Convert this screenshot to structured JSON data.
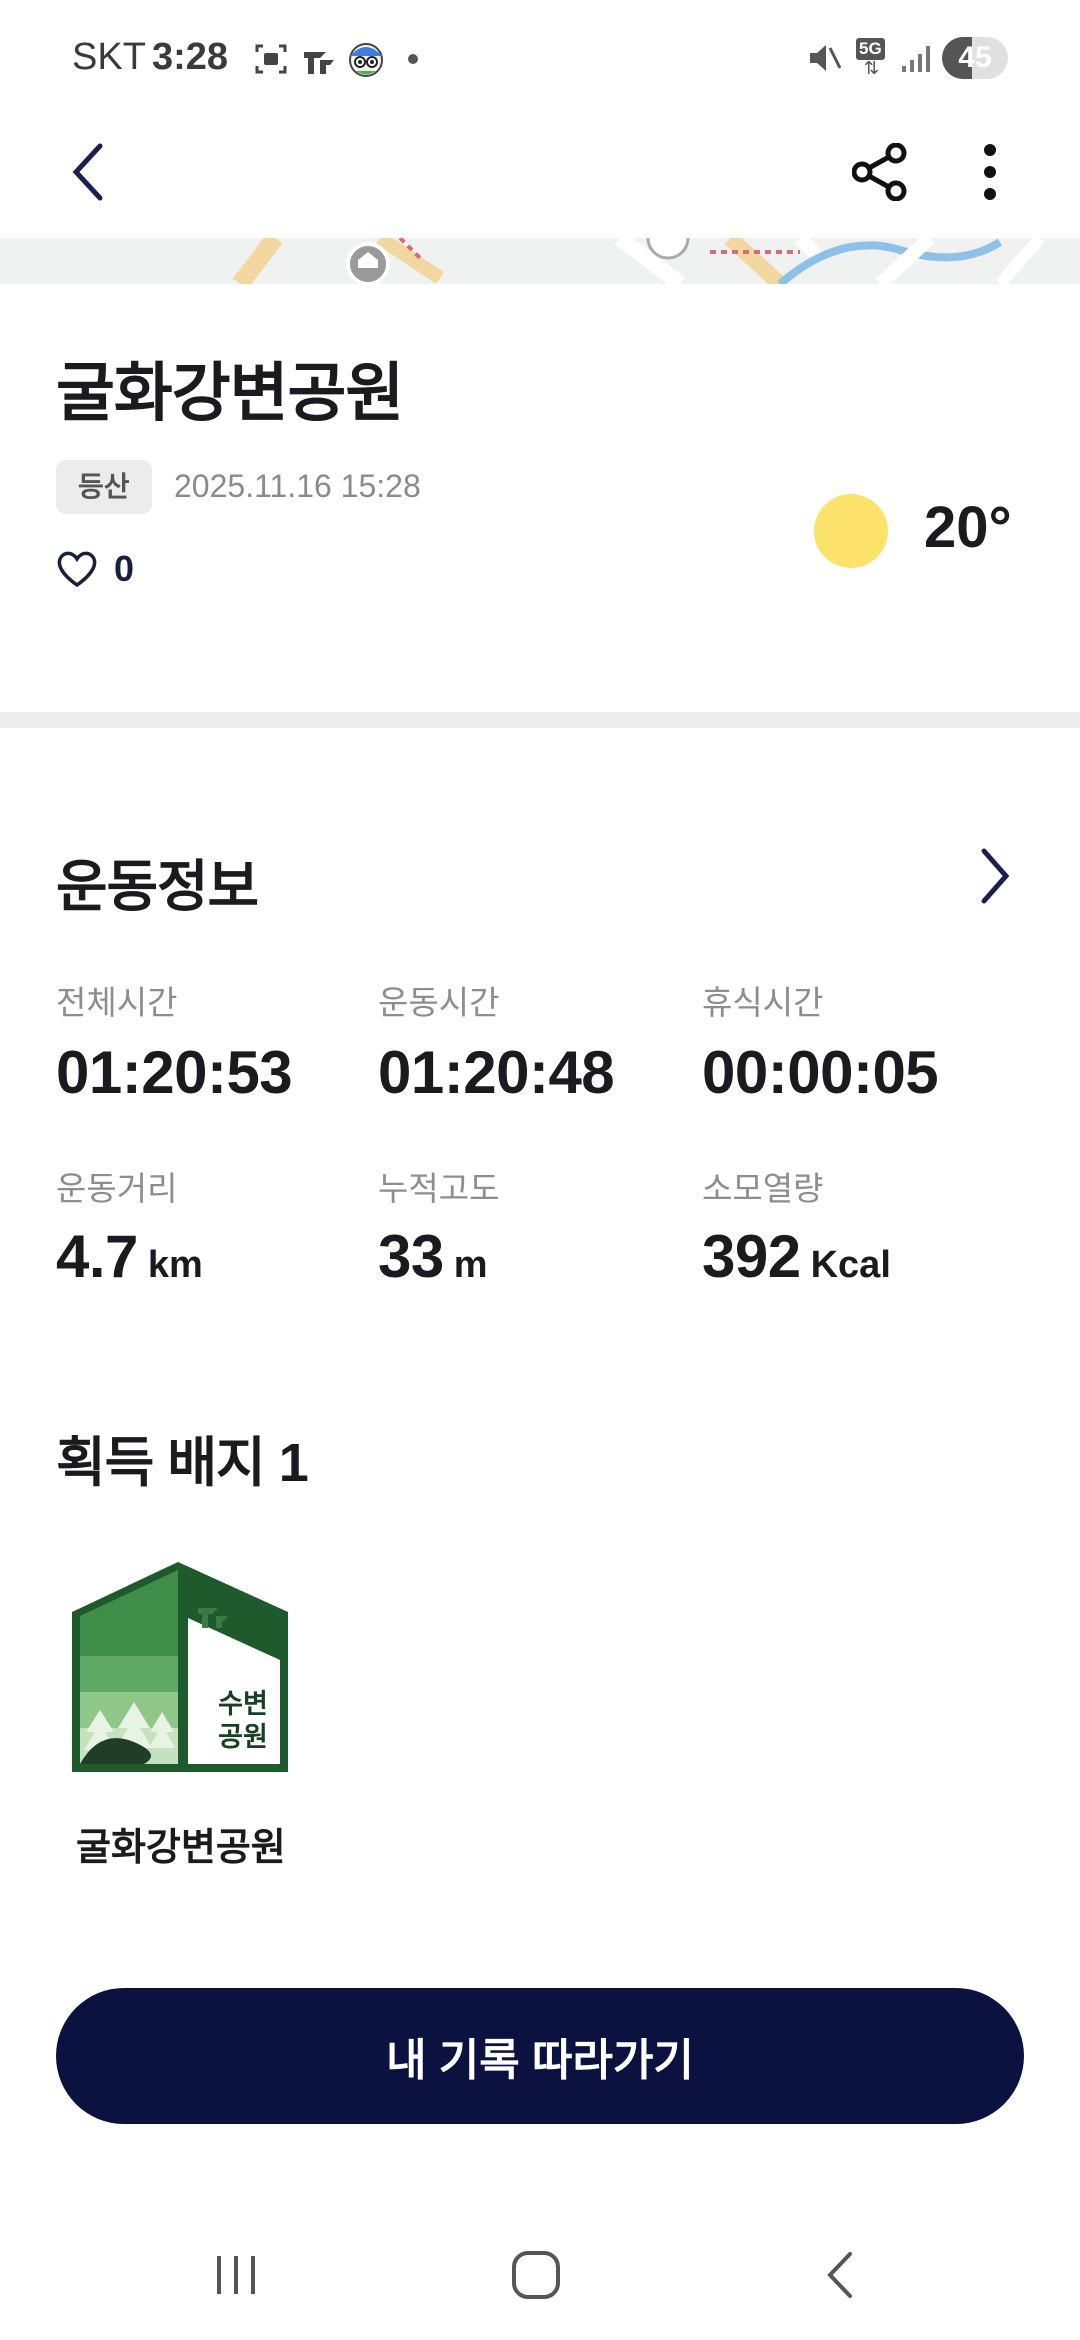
{
  "status_bar": {
    "carrier": "SKT",
    "time": "3:28",
    "network": "5G",
    "battery": "45"
  },
  "place": {
    "title": "굴화강변공원",
    "category": "등산",
    "datetime": "2025.11.16 15:28",
    "likes": "0"
  },
  "weather": {
    "icon": "sun-icon",
    "temperature": "20°"
  },
  "exercise": {
    "section_title": "운동정보",
    "stats": [
      {
        "label": "전체시간",
        "value": "01:20:53",
        "unit": ""
      },
      {
        "label": "운동시간",
        "value": "01:20:48",
        "unit": ""
      },
      {
        "label": "휴식시간",
        "value": "00:00:05",
        "unit": ""
      },
      {
        "label": "운동거리",
        "value": "4.7",
        "unit": "km"
      },
      {
        "label": "누적고도",
        "value": "33",
        "unit": "m"
      },
      {
        "label": "소모열량",
        "value": "392",
        "unit": "Kcal"
      }
    ]
  },
  "badges": {
    "section_title": "획득 배지 1",
    "items": [
      {
        "name": "굴화강변공원",
        "emblem_line1": "수변",
        "emblem_line2": "공원",
        "icon": "waterside-park-badge-icon"
      }
    ]
  },
  "cta": {
    "label": "내 기록 따라가기"
  },
  "colors": {
    "primary_navy": "#0c1240",
    "sun_yellow": "#fbe26a",
    "badge_green": "#1f5a2c"
  }
}
